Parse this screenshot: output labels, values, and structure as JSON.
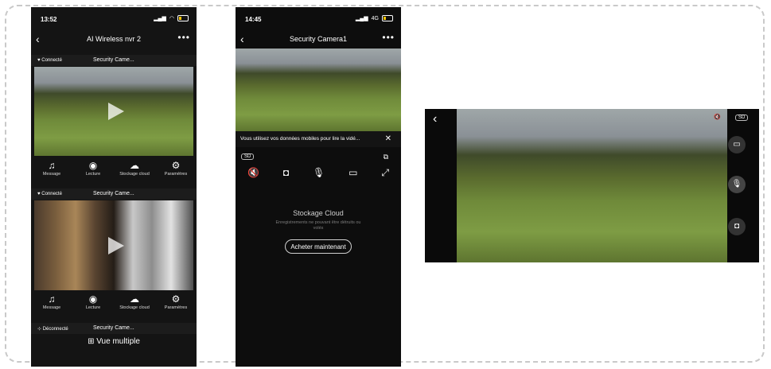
{
  "phone1": {
    "status_time": "13:52",
    "title": "AI Wireless nvr 2",
    "cameras": [
      {
        "status": "Connecté",
        "name": "Security Came..."
      },
      {
        "status": "Connecté",
        "name": "Security Came..."
      },
      {
        "status": "Déconnecté",
        "name": "Security Came..."
      }
    ],
    "actions": [
      {
        "icon": "bell-icon",
        "label": "Message"
      },
      {
        "icon": "play-circle-icon",
        "label": "Lecture"
      },
      {
        "icon": "cloud-icon",
        "label": "Stockage cloud"
      },
      {
        "icon": "gear-icon",
        "label": "Paramètres"
      }
    ],
    "multi_view_label": "Vue multiple"
  },
  "phone2": {
    "status_time": "14:45",
    "network": "4G",
    "title": "Security Camera1",
    "banner_text": "Vous utilisez vos données mobiles pour lire la vidé...",
    "quality_chip": "SD",
    "cloud_title": "Stockage Cloud",
    "cloud_subtitle": "Enregistrements ne pouvant être détruits ou volés",
    "buy_button": "Acheter maintenant"
  },
  "landscape": {
    "quality_chip": "SD"
  }
}
